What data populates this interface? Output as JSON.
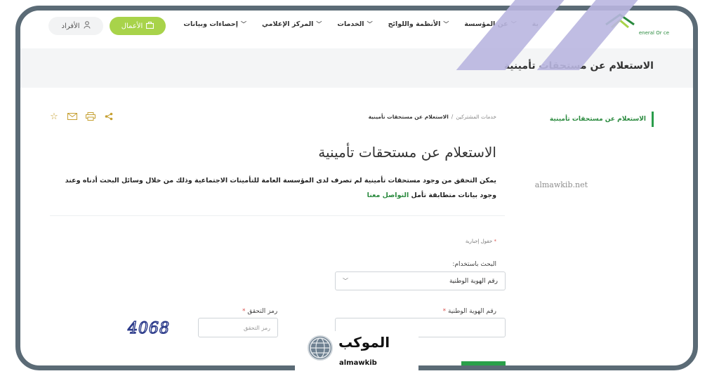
{
  "nav": {
    "items": [
      {
        "label": "عن المؤسسة"
      },
      {
        "label": "الأنظمة واللوائح"
      },
      {
        "label": "الخدمات"
      },
      {
        "label": "المركز الإعلامي"
      },
      {
        "label": "إحصاءات وبيانات"
      }
    ],
    "cut_item": "ية",
    "business_label": "الأعمال",
    "individuals_label": "الأفراد",
    "logo_text": "eneral Or          ce"
  },
  "banner": {
    "title": "الاستعلام عن مستحقات تأمينية"
  },
  "sidebar": {
    "active_item": "الاستعلام عن مستحقات تأمينية"
  },
  "watermark": {
    "site": "almawkib.net"
  },
  "breadcrumb": {
    "parent": "خدمات المشتركين",
    "separator": "/",
    "current": "الاستعلام عن مستحقات تأمينية"
  },
  "main": {
    "title": "الاستعلام عن مستحقات تأمينية",
    "description": "يمكن التحقق من وجود مستحقات تأمينية لم تصرف لدى المؤسسة العامة للتأمينات الاجتماعية وذلك من خلال وسائل البحث أدناه وعند وجود بيانات متطابقة تأمل",
    "contact_link": "التواصل معنا"
  },
  "form": {
    "required_note": "حقول إجبارية",
    "search_by_label": "البحث باستخدام:",
    "search_by_value": "رقم الهوية الوطنية",
    "national_id_label": "رقم الهوية الوطنية",
    "captcha_label": "رمز التحقق",
    "captcha_placeholder": "رمز التحقق",
    "captcha_text": "4068"
  },
  "badge": {
    "arabic": "الموكب",
    "english": "almawkib"
  },
  "colors": {
    "primary_green": "#2aa04a",
    "lime": "#a8d34a",
    "frame": "#5b6b76",
    "accent_purple": "#b9b6e0"
  }
}
